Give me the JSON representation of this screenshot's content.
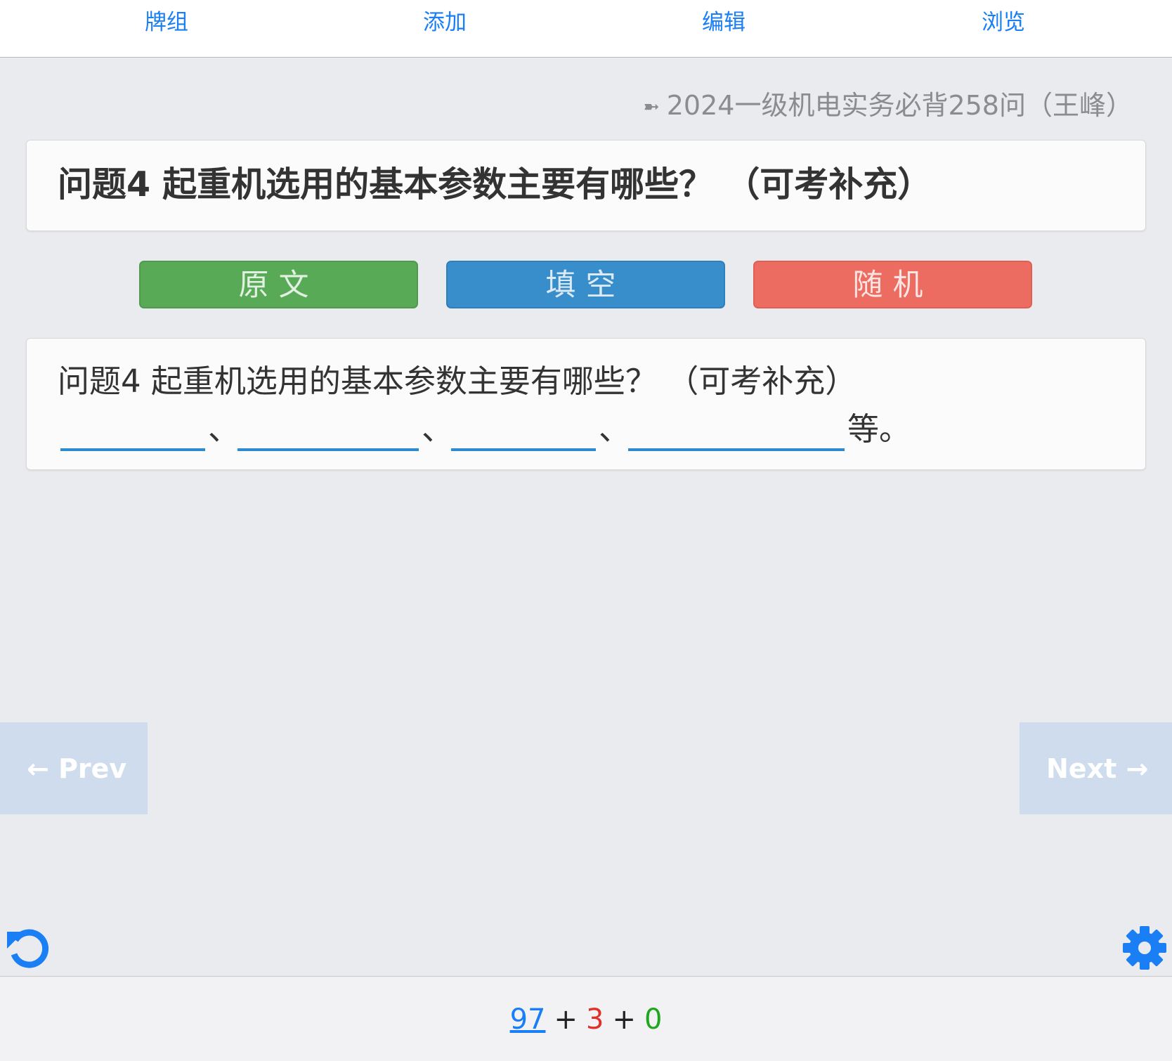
{
  "nav": {
    "decks": "牌组",
    "add": "添加",
    "edit": "编辑",
    "browse": "浏览"
  },
  "deck": {
    "icon": "➼",
    "title": "2024一级机电实务必背258问（王峰）"
  },
  "question": {
    "title": "问题4 起重机选用的基本参数主要有哪些？ （可考补充）"
  },
  "modes": {
    "original": "原文",
    "cloze": "填空",
    "random": "随机"
  },
  "answer": {
    "line1": "问题4 起重机选用的基本参数主要有哪些？ （可考补充）",
    "separator": "、",
    "ending": "等。"
  },
  "pager": {
    "prev": "← Prev",
    "next": "Next →"
  },
  "counts": {
    "new": "97",
    "learn": "3",
    "review": "0",
    "plus": "+"
  },
  "colors": {
    "accent": "#1a7ff5",
    "green": "#58aa57",
    "blue": "#388dcb",
    "red": "#ed6c61"
  }
}
